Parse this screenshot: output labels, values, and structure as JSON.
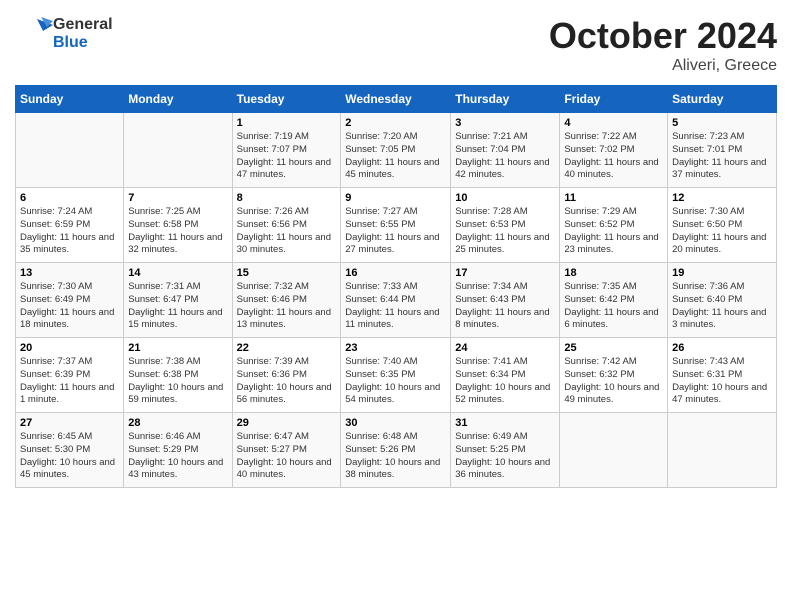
{
  "header": {
    "logo_line1": "General",
    "logo_line2": "Blue",
    "month": "October 2024",
    "location": "Aliveri, Greece"
  },
  "days_of_week": [
    "Sunday",
    "Monday",
    "Tuesday",
    "Wednesday",
    "Thursday",
    "Friday",
    "Saturday"
  ],
  "weeks": [
    [
      {
        "day": "",
        "info": ""
      },
      {
        "day": "",
        "info": ""
      },
      {
        "day": "1",
        "info": "Sunrise: 7:19 AM\nSunset: 7:07 PM\nDaylight: 11 hours and 47 minutes."
      },
      {
        "day": "2",
        "info": "Sunrise: 7:20 AM\nSunset: 7:05 PM\nDaylight: 11 hours and 45 minutes."
      },
      {
        "day": "3",
        "info": "Sunrise: 7:21 AM\nSunset: 7:04 PM\nDaylight: 11 hours and 42 minutes."
      },
      {
        "day": "4",
        "info": "Sunrise: 7:22 AM\nSunset: 7:02 PM\nDaylight: 11 hours and 40 minutes."
      },
      {
        "day": "5",
        "info": "Sunrise: 7:23 AM\nSunset: 7:01 PM\nDaylight: 11 hours and 37 minutes."
      }
    ],
    [
      {
        "day": "6",
        "info": "Sunrise: 7:24 AM\nSunset: 6:59 PM\nDaylight: 11 hours and 35 minutes."
      },
      {
        "day": "7",
        "info": "Sunrise: 7:25 AM\nSunset: 6:58 PM\nDaylight: 11 hours and 32 minutes."
      },
      {
        "day": "8",
        "info": "Sunrise: 7:26 AM\nSunset: 6:56 PM\nDaylight: 11 hours and 30 minutes."
      },
      {
        "day": "9",
        "info": "Sunrise: 7:27 AM\nSunset: 6:55 PM\nDaylight: 11 hours and 27 minutes."
      },
      {
        "day": "10",
        "info": "Sunrise: 7:28 AM\nSunset: 6:53 PM\nDaylight: 11 hours and 25 minutes."
      },
      {
        "day": "11",
        "info": "Sunrise: 7:29 AM\nSunset: 6:52 PM\nDaylight: 11 hours and 23 minutes."
      },
      {
        "day": "12",
        "info": "Sunrise: 7:30 AM\nSunset: 6:50 PM\nDaylight: 11 hours and 20 minutes."
      }
    ],
    [
      {
        "day": "13",
        "info": "Sunrise: 7:30 AM\nSunset: 6:49 PM\nDaylight: 11 hours and 18 minutes."
      },
      {
        "day": "14",
        "info": "Sunrise: 7:31 AM\nSunset: 6:47 PM\nDaylight: 11 hours and 15 minutes."
      },
      {
        "day": "15",
        "info": "Sunrise: 7:32 AM\nSunset: 6:46 PM\nDaylight: 11 hours and 13 minutes."
      },
      {
        "day": "16",
        "info": "Sunrise: 7:33 AM\nSunset: 6:44 PM\nDaylight: 11 hours and 11 minutes."
      },
      {
        "day": "17",
        "info": "Sunrise: 7:34 AM\nSunset: 6:43 PM\nDaylight: 11 hours and 8 minutes."
      },
      {
        "day": "18",
        "info": "Sunrise: 7:35 AM\nSunset: 6:42 PM\nDaylight: 11 hours and 6 minutes."
      },
      {
        "day": "19",
        "info": "Sunrise: 7:36 AM\nSunset: 6:40 PM\nDaylight: 11 hours and 3 minutes."
      }
    ],
    [
      {
        "day": "20",
        "info": "Sunrise: 7:37 AM\nSunset: 6:39 PM\nDaylight: 11 hours and 1 minute."
      },
      {
        "day": "21",
        "info": "Sunrise: 7:38 AM\nSunset: 6:38 PM\nDaylight: 10 hours and 59 minutes."
      },
      {
        "day": "22",
        "info": "Sunrise: 7:39 AM\nSunset: 6:36 PM\nDaylight: 10 hours and 56 minutes."
      },
      {
        "day": "23",
        "info": "Sunrise: 7:40 AM\nSunset: 6:35 PM\nDaylight: 10 hours and 54 minutes."
      },
      {
        "day": "24",
        "info": "Sunrise: 7:41 AM\nSunset: 6:34 PM\nDaylight: 10 hours and 52 minutes."
      },
      {
        "day": "25",
        "info": "Sunrise: 7:42 AM\nSunset: 6:32 PM\nDaylight: 10 hours and 49 minutes."
      },
      {
        "day": "26",
        "info": "Sunrise: 7:43 AM\nSunset: 6:31 PM\nDaylight: 10 hours and 47 minutes."
      }
    ],
    [
      {
        "day": "27",
        "info": "Sunrise: 6:45 AM\nSunset: 5:30 PM\nDaylight: 10 hours and 45 minutes."
      },
      {
        "day": "28",
        "info": "Sunrise: 6:46 AM\nSunset: 5:29 PM\nDaylight: 10 hours and 43 minutes."
      },
      {
        "day": "29",
        "info": "Sunrise: 6:47 AM\nSunset: 5:27 PM\nDaylight: 10 hours and 40 minutes."
      },
      {
        "day": "30",
        "info": "Sunrise: 6:48 AM\nSunset: 5:26 PM\nDaylight: 10 hours and 38 minutes."
      },
      {
        "day": "31",
        "info": "Sunrise: 6:49 AM\nSunset: 5:25 PM\nDaylight: 10 hours and 36 minutes."
      },
      {
        "day": "",
        "info": ""
      },
      {
        "day": "",
        "info": ""
      }
    ]
  ]
}
